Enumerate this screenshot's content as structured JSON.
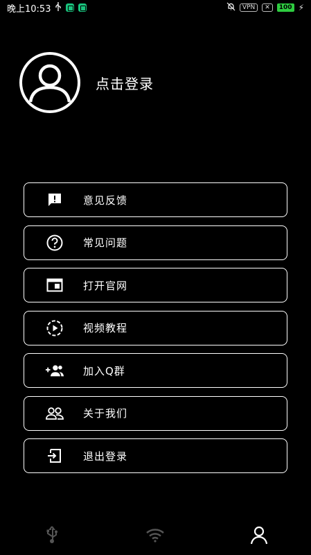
{
  "status_bar": {
    "time": "晚上10:53",
    "vpn": "VPN",
    "battery": "100"
  },
  "profile": {
    "login_label": "点击登录"
  },
  "menu": {
    "items": [
      {
        "label": "意见反馈",
        "icon": "feedback-icon"
      },
      {
        "label": "常见问题",
        "icon": "help-circle-icon"
      },
      {
        "label": "打开官网",
        "icon": "browser-window-icon"
      },
      {
        "label": "视频教程",
        "icon": "play-circle-icon"
      },
      {
        "label": "加入Q群",
        "icon": "group-add-icon"
      },
      {
        "label": "关于我们",
        "icon": "people-icon"
      },
      {
        "label": "退出登录",
        "icon": "logout-icon"
      }
    ]
  },
  "bottom_nav": {
    "items": [
      {
        "icon": "usb-icon",
        "active": false
      },
      {
        "icon": "wifi-icon",
        "active": false
      },
      {
        "icon": "user-icon",
        "active": true
      }
    ]
  },
  "colors": {
    "background": "#000000",
    "foreground": "#ffffff",
    "inactive_nav": "#555555",
    "battery": "#2ecc40"
  }
}
